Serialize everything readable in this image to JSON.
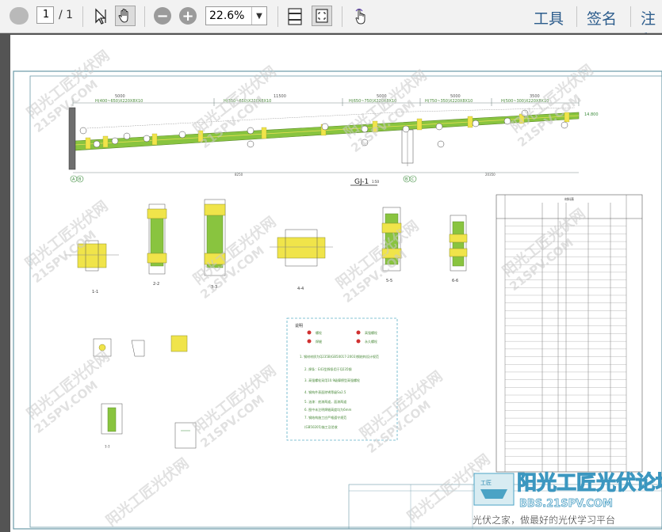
{
  "toolbar": {
    "page_current": "1",
    "page_total": "/ 1",
    "zoom": "22.6%",
    "tools_label": "工具",
    "sign_label": "签名",
    "comment_label": "注释"
  },
  "drawing": {
    "frame_label": "GJ-1",
    "frame_scale": "1:50",
    "dims_top": [
      "5000",
      "11500",
      "5000",
      "5000",
      "3500"
    ],
    "members_top": [
      "H(400~650)X220X8X10",
      "H(350~650)X220X8X10",
      "H(650~750)X220X8X10",
      "H(750~350)X220X8X10",
      "H(500~300)X220X8X10"
    ],
    "axis_labels": [
      "A",
      "B",
      "B",
      "C",
      "E"
    ],
    "elevation_right": "14.800",
    "section_labels": [
      "1-1",
      "2-2",
      "3-3",
      "4-4",
      "5-5",
      "6-6",
      "7-7"
    ],
    "notes_title": "说明",
    "legend_items": [
      "螺栓",
      "高强螺栓",
      "焊缝",
      "永久螺栓"
    ],
    "notes": [
      "1. 钢材材质为Q235B(GB50017-2003)钢结构设计规范",
      "2. 焊条：E43型焊条用于Q235钢",
      "3. 高强螺栓采用10.9级摩擦型高强螺栓",
      "4. 钢构件表面除锈等级Sa2.5",
      "5. 油漆：底漆两道，面漆两道",
      "6. 图中未注明焊缝高度均为6mm",
      "7. 钢结构施工应严格遵守规范"
    ],
    "notes_code": "(GB50205)施工及验收",
    "table_title": "材料表",
    "table_headers": [
      "构件编号",
      "零件号",
      "规格",
      "长度",
      "数量",
      "单重",
      "总重",
      "备注"
    ],
    "row_count": 33
  },
  "watermarks": {
    "lines": [
      "阳光工匠光伏网",
      "21SPV.COM"
    ],
    "brand": "阳光工匠光伏论坛",
    "brand_url": "BBS.21SPV.COM",
    "slogan": "光伏之家，做最好的光伏学习平台"
  }
}
